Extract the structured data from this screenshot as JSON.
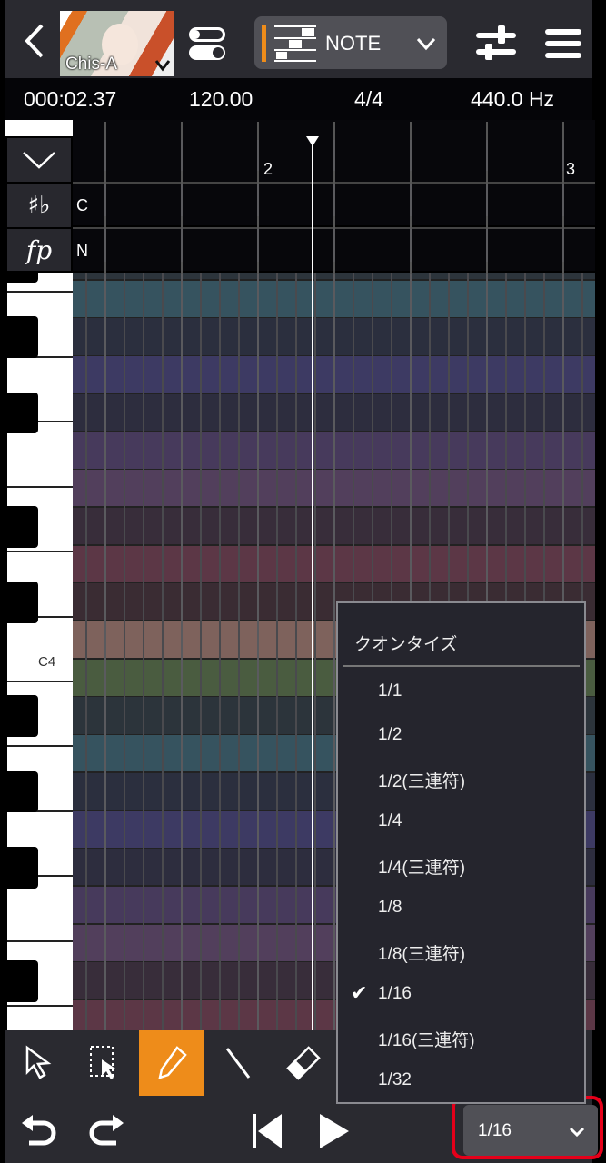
{
  "header": {
    "singer_name": "Chis-A",
    "mode_label": "NOTE"
  },
  "info": {
    "time": "000:02.37",
    "tempo": "120.00",
    "time_signature": "4/4",
    "pitch_ref": "440.0 Hz"
  },
  "ruler": {
    "bar_labels": [
      "2",
      "3"
    ]
  },
  "lanes": {
    "key_value": "C",
    "dynamics_value": "N"
  },
  "piano": {
    "c4_label": "C4"
  },
  "quantize_menu": {
    "title": "クオンタイズ",
    "options": [
      "1/1",
      "1/2",
      "1/2(三連符)",
      "1/4",
      "1/4(三連符)",
      "1/8",
      "1/8(三連符)",
      "1/16",
      "1/16(三連符)",
      "1/32"
    ],
    "selected": "1/16"
  },
  "quantize_select": {
    "value": "1/16"
  },
  "colors": {
    "accent": "#ee8c1a",
    "highlight": "#e5001a"
  }
}
